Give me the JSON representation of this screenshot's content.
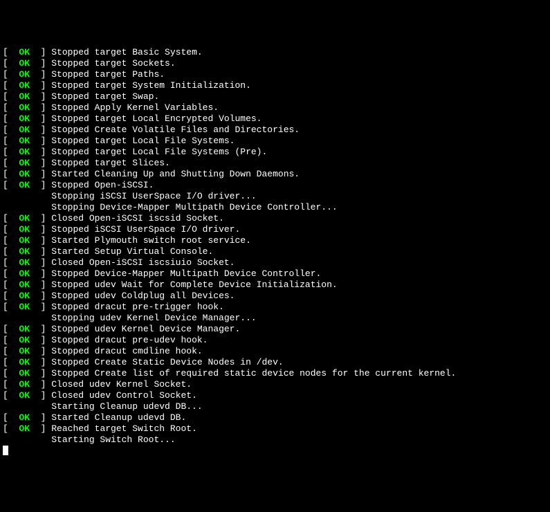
{
  "status_ok": "OK",
  "bracket_open": "[  ",
  "bracket_close": "  ] ",
  "lines": [
    {
      "type": "ok",
      "msg": "Stopped target Basic System."
    },
    {
      "type": "ok",
      "msg": "Stopped target Sockets."
    },
    {
      "type": "ok",
      "msg": "Stopped target Paths."
    },
    {
      "type": "ok",
      "msg": "Stopped target System Initialization."
    },
    {
      "type": "ok",
      "msg": "Stopped target Swap."
    },
    {
      "type": "ok",
      "msg": "Stopped Apply Kernel Variables."
    },
    {
      "type": "ok",
      "msg": "Stopped target Local Encrypted Volumes."
    },
    {
      "type": "ok",
      "msg": "Stopped Create Volatile Files and Directories."
    },
    {
      "type": "ok",
      "msg": "Stopped target Local File Systems."
    },
    {
      "type": "ok",
      "msg": "Stopped target Local File Systems (Pre)."
    },
    {
      "type": "ok",
      "msg": "Stopped target Slices."
    },
    {
      "type": "ok",
      "msg": "Started Cleaning Up and Shutting Down Daemons."
    },
    {
      "type": "ok",
      "msg": "Stopped Open-iSCSI."
    },
    {
      "type": "plain",
      "msg": "Stopping iSCSI UserSpace I/O driver..."
    },
    {
      "type": "plain",
      "msg": "Stopping Device-Mapper Multipath Device Controller..."
    },
    {
      "type": "ok",
      "msg": "Closed Open-iSCSI iscsid Socket."
    },
    {
      "type": "ok",
      "msg": "Stopped iSCSI UserSpace I/O driver."
    },
    {
      "type": "ok",
      "msg": "Started Plymouth switch root service."
    },
    {
      "type": "ok",
      "msg": "Started Setup Virtual Console."
    },
    {
      "type": "ok",
      "msg": "Closed Open-iSCSI iscsiuio Socket."
    },
    {
      "type": "ok",
      "msg": "Stopped Device-Mapper Multipath Device Controller."
    },
    {
      "type": "ok",
      "msg": "Stopped udev Wait for Complete Device Initialization."
    },
    {
      "type": "ok",
      "msg": "Stopped udev Coldplug all Devices."
    },
    {
      "type": "ok",
      "msg": "Stopped dracut pre-trigger hook."
    },
    {
      "type": "plain",
      "msg": "Stopping udev Kernel Device Manager..."
    },
    {
      "type": "ok",
      "msg": "Stopped udev Kernel Device Manager."
    },
    {
      "type": "ok",
      "msg": "Stopped dracut pre-udev hook."
    },
    {
      "type": "ok",
      "msg": "Stopped dracut cmdline hook."
    },
    {
      "type": "ok",
      "msg": "Stopped Create Static Device Nodes in /dev."
    },
    {
      "type": "ok",
      "msg": "Stopped Create list of required static device nodes for the current kernel."
    },
    {
      "type": "ok",
      "msg": "Closed udev Kernel Socket."
    },
    {
      "type": "ok",
      "msg": "Closed udev Control Socket."
    },
    {
      "type": "plain",
      "msg": "Starting Cleanup udevd DB..."
    },
    {
      "type": "ok",
      "msg": "Started Cleanup udevd DB."
    },
    {
      "type": "ok",
      "msg": "Reached target Switch Root."
    },
    {
      "type": "plain",
      "msg": "Starting Switch Root..."
    }
  ]
}
